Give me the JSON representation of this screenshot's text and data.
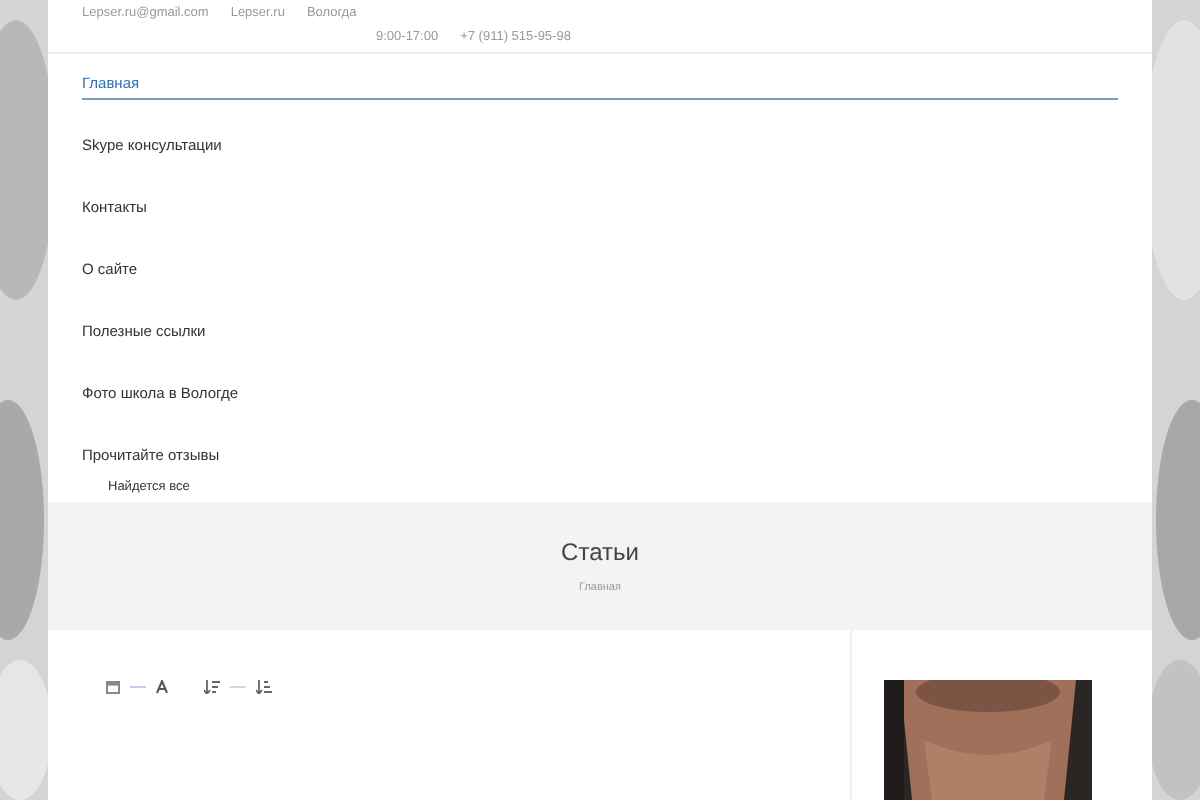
{
  "topbar": {
    "contacts": [
      "Lepser.ru@gmail.com",
      "Lepser.ru",
      "Вологда"
    ],
    "details": [
      "9:00-17:00",
      "+7 (911) 515-95-98"
    ]
  },
  "menu": [
    {
      "label": "Главная",
      "selected": true
    },
    {
      "label": "Skype консультации",
      "selected": false
    },
    {
      "label": "Контакты",
      "selected": false
    },
    {
      "label": "О сайте",
      "selected": false
    },
    {
      "label": "Полезные ссылки",
      "selected": false
    },
    {
      "label": "Фото школа в Вологде",
      "selected": false
    },
    {
      "label": "Прочитайте отзывы",
      "selected": false,
      "children": [
        {
          "label": "Найдется все"
        }
      ]
    }
  ],
  "banner": {
    "title": "Статьи",
    "breadcrumb": "Главная"
  }
}
